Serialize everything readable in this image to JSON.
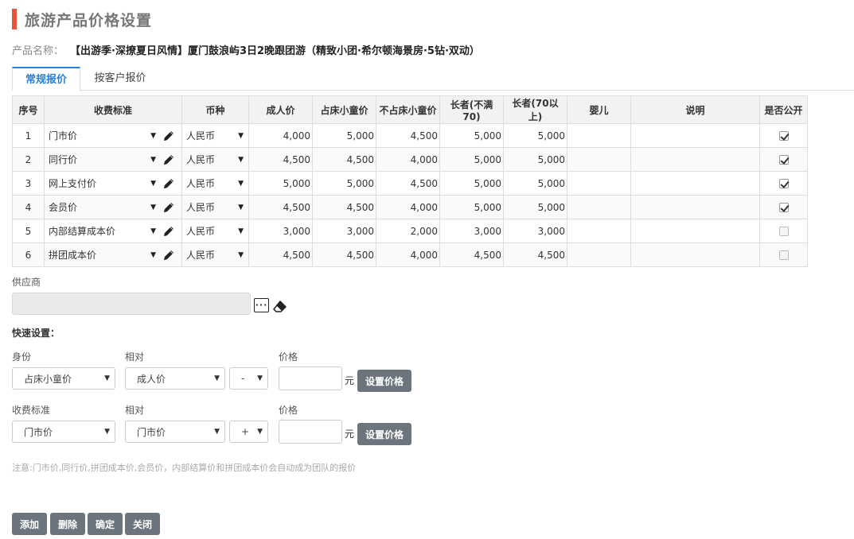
{
  "page": {
    "title": "旅游产品价格设置"
  },
  "product": {
    "label": "产品名称：",
    "name": "【出游季·深撩夏日风情】厦门鼓浪屿3日2晚跟团游（精致小团·希尔顿海景房·5钻·双动）"
  },
  "tabs": [
    {
      "label": "常规报价"
    },
    {
      "label": "按客户报价"
    }
  ],
  "table": {
    "headers": [
      "序号",
      "收费标准",
      "币种",
      "成人价",
      "占床小童价",
      "不占床小童价",
      "长者(不满70)",
      "长者(70以上)",
      "婴儿",
      "说明",
      "是否公开"
    ],
    "rows": [
      {
        "no": "1",
        "standard": "门市价",
        "currency": "人民币",
        "adult": "4,000",
        "child_bed": "5,000",
        "child_nobed": "4,500",
        "senior_lt70": "5,000",
        "senior_gt70": "5,000",
        "infant": "",
        "note": "",
        "public": true
      },
      {
        "no": "2",
        "standard": "同行价",
        "currency": "人民币",
        "adult": "4,500",
        "child_bed": "4,500",
        "child_nobed": "4,000",
        "senior_lt70": "5,000",
        "senior_gt70": "5,000",
        "infant": "",
        "note": "",
        "public": true
      },
      {
        "no": "3",
        "standard": "网上支付价",
        "currency": "人民币",
        "adult": "5,000",
        "child_bed": "5,000",
        "child_nobed": "4,500",
        "senior_lt70": "5,000",
        "senior_gt70": "5,000",
        "infant": "",
        "note": "",
        "public": true
      },
      {
        "no": "4",
        "standard": "会员价",
        "currency": "人民币",
        "adult": "4,500",
        "child_bed": "4,500",
        "child_nobed": "4,000",
        "senior_lt70": "5,000",
        "senior_gt70": "5,000",
        "infant": "",
        "note": "",
        "public": true
      },
      {
        "no": "5",
        "standard": "内部结算成本价",
        "currency": "人民币",
        "adult": "3,000",
        "child_bed": "3,000",
        "child_nobed": "2,000",
        "senior_lt70": "3,000",
        "senior_gt70": "3,000",
        "infant": "",
        "note": "",
        "public": false
      },
      {
        "no": "6",
        "standard": "拼团成本价",
        "currency": "人民币",
        "adult": "4,500",
        "child_bed": "4,500",
        "child_nobed": "4,000",
        "senior_lt70": "4,500",
        "senior_gt70": "4,500",
        "infant": "",
        "note": "",
        "public": false
      }
    ]
  },
  "supplier": {
    "label": "供应商",
    "value": ""
  },
  "quick": {
    "title": "快速设置：",
    "row1": {
      "identity_label": "身份",
      "identity_value": "占床小童价",
      "relative_label": "相对",
      "relative_value": "成人价",
      "op_value": "-",
      "price_label": "价格",
      "price_value": "",
      "unit": "元",
      "button": "设置价格"
    },
    "row2": {
      "standard_label": "收费标准",
      "standard_value": "门市价",
      "relative_label": "相对",
      "relative_value": "门市价",
      "op_value": "+",
      "price_label": "价格",
      "price_value": "",
      "unit": "元",
      "button": "设置价格"
    }
  },
  "note": "注意:门市价,同行价,拼团成本价,会员价，内部结算价和拼团成本价会自动成为团队的报价",
  "actions": {
    "add": "添加",
    "delete": "删除",
    "confirm": "确定",
    "close": "关闭"
  },
  "colors": {
    "accent": "#e8543c",
    "tab_active": "#2a7fd4",
    "button": "#6c757d"
  }
}
